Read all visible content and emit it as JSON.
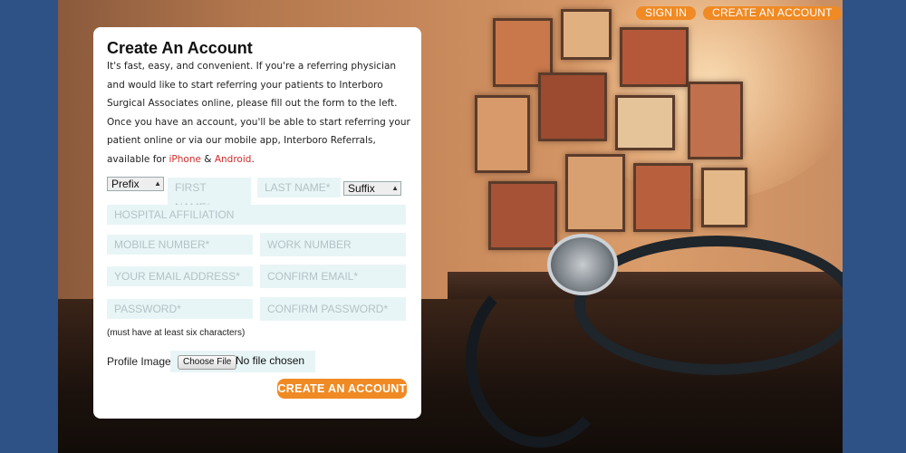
{
  "colors": {
    "accent": "#f08a24",
    "link": "#d22a2a",
    "input_bg": "#e8f5f6",
    "page_bg": "#2e5186"
  },
  "top_nav": {
    "sign_in": "SIGN IN",
    "create_account": "CREATE AN ACCOUNT"
  },
  "form": {
    "title": "Create An Account",
    "intro_text": "It's fast, easy, and convenient. If you're a referring physician and would like to start referring your patients to Interboro Surgical Associates online, please fill out the form to the left. Once you have an account, you'll be able to start referring your patient online or via our mobile app, Interboro Referrals, available for",
    "iphone_link": "iPhone",
    "and_text": " & ",
    "android_link": "Android",
    "period": ".",
    "prefix_select": "Prefix",
    "suffix_select": "Suffix",
    "first_name_placeholder": "FIRST NAME*",
    "last_name_placeholder": "LAST NAME*",
    "hospital_placeholder": "HOSPITAL AFFILIATION",
    "mobile_placeholder": "MOBILE NUMBER*",
    "work_placeholder": "WORK NUMBER",
    "email_placeholder": "YOUR EMAIL ADDRESS*",
    "confirm_email_placeholder": "CONFIRM EMAIL*",
    "password_placeholder": "PASSWORD*",
    "confirm_password_placeholder": "CONFIRM PASSWORD*",
    "password_note": "(must have at least six characters)",
    "profile_image_label": "Profile Image",
    "choose_file_button": "Choose File",
    "no_file_text": "No file chosen",
    "submit_button": "CREATE AN ACCOUNT"
  }
}
